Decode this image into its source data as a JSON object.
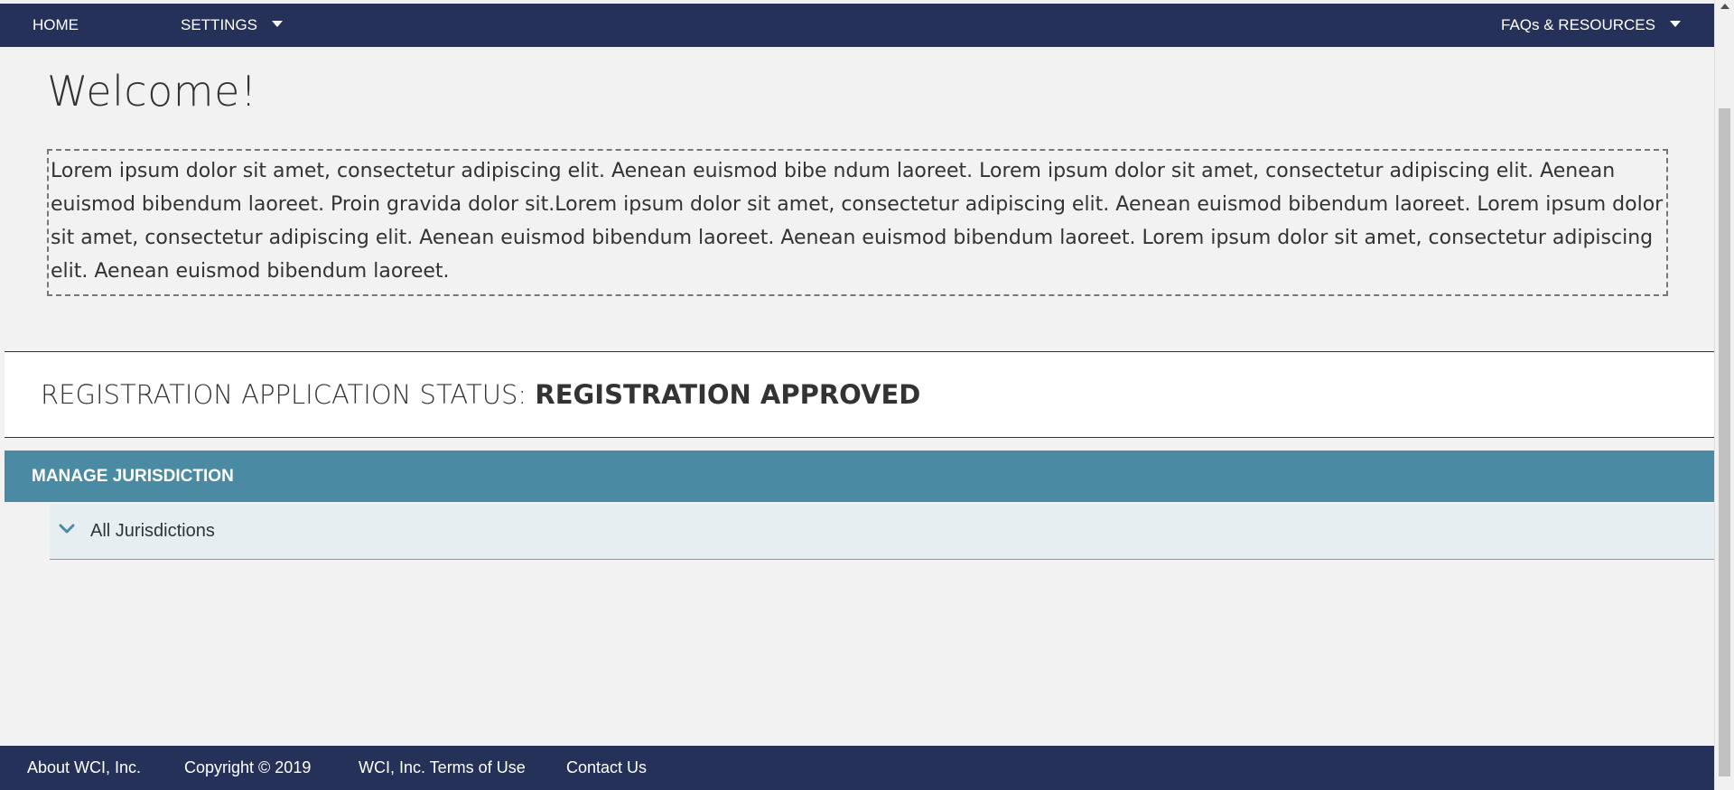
{
  "nav": {
    "home": "HOME",
    "settings": "SETTINGS",
    "faqs": "FAQs & RESOURCES"
  },
  "welcome": {
    "title": "Welcome!",
    "body": "Lorem ipsum dolor sit amet, consectetur adipiscing elit. Aenean euismod bibe ndum laoreet. Lorem ipsum dolor sit amet, consectetur adipiscing elit. Aenean euismod bibendum laoreet. Proin gravida dolor sit.Lorem ipsum dolor sit amet, consectetur adipiscing elit. Aenean euismod bibendum laoreet. Lorem ipsum dolor sit amet, consectetur adipiscing elit. Aenean euismod bibendum laoreet. Aenean euismod bibendum laoreet. Lorem ipsum dolor sit amet, consectetur adipiscing elit. Aenean euismod bibendum laoreet."
  },
  "status": {
    "label": "REGISTRATION APPLICATION STATUS:",
    "value": "REGISTRATION APPROVED"
  },
  "manage": {
    "title": "MANAGE JURISDICTION",
    "row_label": "All Jurisdictions"
  },
  "footer": {
    "about": "About WCI, Inc.",
    "copyright": "Copyright © 2019",
    "terms": "WCI, Inc. Terms of Use",
    "contact": "Contact Us"
  },
  "colors": {
    "navy": "#263159",
    "teal": "#4a8aa3",
    "row_bg": "#e6eef1",
    "page_bg": "#f2f2f2"
  },
  "icons": {
    "settings_caret": "caret-down-icon",
    "faqs_caret": "caret-down-icon",
    "row_chevron": "chevron-down-icon"
  }
}
